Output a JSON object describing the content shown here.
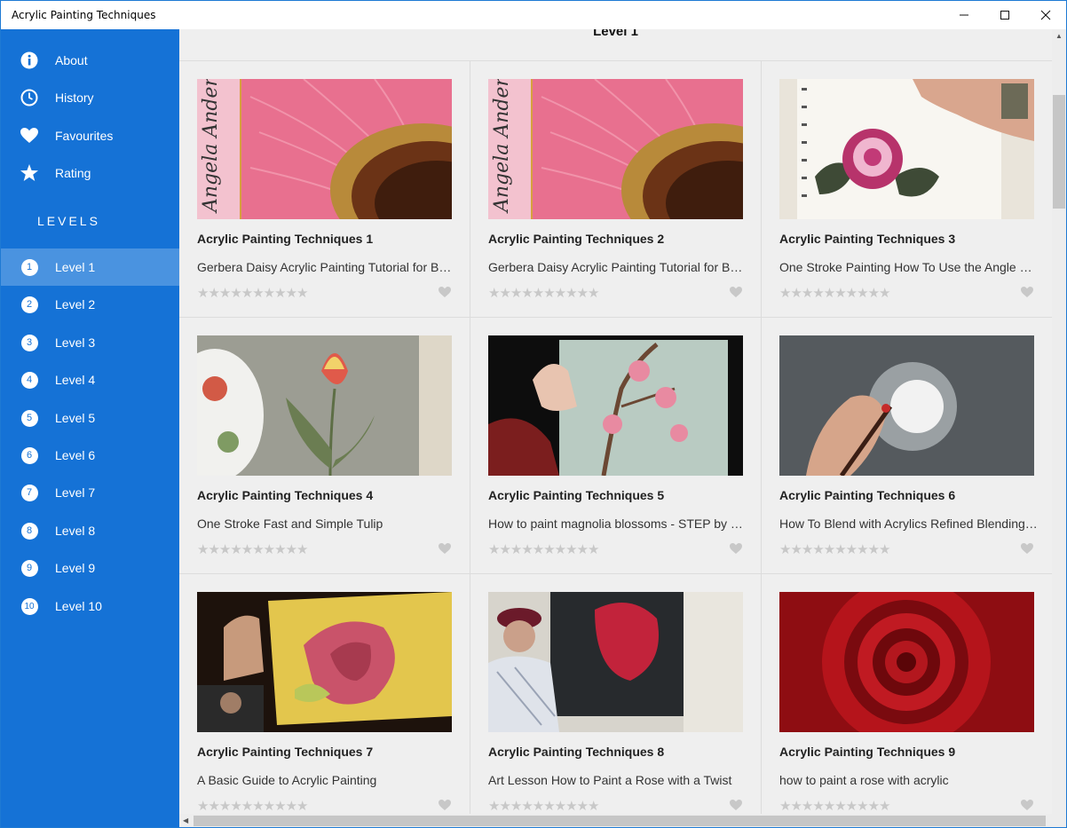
{
  "window": {
    "title": "Acrylic Painting Techniques"
  },
  "sidebar": {
    "menu": [
      {
        "label": "About",
        "icon": "info-icon"
      },
      {
        "label": "History",
        "icon": "clock-icon"
      },
      {
        "label": "Favourites",
        "icon": "heart-icon"
      },
      {
        "label": "Rating",
        "icon": "star-icon"
      }
    ],
    "levels_heading": "LEVELS",
    "levels": [
      {
        "num": "1",
        "label": "Level 1"
      },
      {
        "num": "2",
        "label": "Level 2"
      },
      {
        "num": "3",
        "label": "Level 3"
      },
      {
        "num": "4",
        "label": "Level 4"
      },
      {
        "num": "5",
        "label": "Level 5"
      },
      {
        "num": "6",
        "label": "Level 6"
      },
      {
        "num": "7",
        "label": "Level 7"
      },
      {
        "num": "8",
        "label": "Level 8"
      },
      {
        "num": "9",
        "label": "Level 9"
      },
      {
        "num": "10",
        "label": "Level 10"
      }
    ],
    "active_level": "Level 1"
  },
  "main": {
    "heading": "Level 1",
    "cards": [
      {
        "title": "Acrylic Painting Techniques 1",
        "desc": "Gerbera Daisy Acrylic Painting Tutorial for Beginners",
        "stars": "★★★★★★★★★★"
      },
      {
        "title": "Acrylic Painting Techniques 2",
        "desc": "Gerbera Daisy Acrylic Painting Tutorial for Beginners",
        "stars": "★★★★★★★★★★"
      },
      {
        "title": "Acrylic Painting Techniques 3",
        "desc": "One Stroke Painting How To Use the Angle Brush",
        "stars": "★★★★★★★★★★"
      },
      {
        "title": "Acrylic Painting Techniques 4",
        "desc": "One Stroke Fast and Simple Tulip",
        "stars": "★★★★★★★★★★"
      },
      {
        "title": "Acrylic Painting Techniques 5",
        "desc": "How to paint magnolia blossoms - STEP by STEP",
        "stars": "★★★★★★★★★★"
      },
      {
        "title": "Acrylic Painting Techniques 6",
        "desc": "How To Blend with Acrylics Refined Blending Technique",
        "stars": "★★★★★★★★★★"
      },
      {
        "title": "Acrylic Painting Techniques 7",
        "desc": "A Basic Guide to Acrylic Painting",
        "stars": "★★★★★★★★★★"
      },
      {
        "title": "Acrylic Painting Techniques 8",
        "desc": "Art Lesson How to Paint a Rose with a Twist",
        "stars": "★★★★★★★★★★"
      },
      {
        "title": "Acrylic Painting Techniques 9",
        "desc": "how to paint a rose with acrylic",
        "stars": "★★★★★★★★★★"
      }
    ]
  },
  "colors": {
    "sidebar": "#1572d6",
    "active_item": "#4a93e0",
    "content_bg": "#efefef"
  }
}
